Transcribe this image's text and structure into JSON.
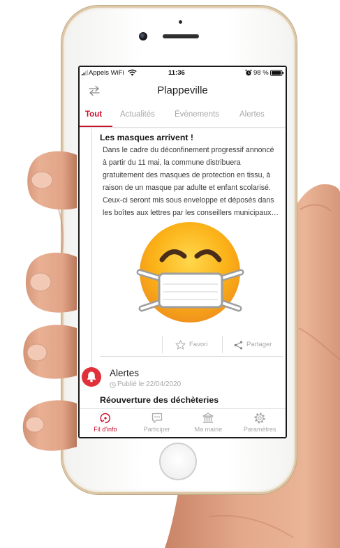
{
  "status_bar": {
    "carrier": "Appels WiFi",
    "time": "11:36",
    "battery": "98 %"
  },
  "header": {
    "title": "Plappeville",
    "left_icon": "swap-arrows-icon"
  },
  "tabs": [
    {
      "label": "Tout",
      "active": true
    },
    {
      "label": "Actualités",
      "active": false
    },
    {
      "label": "Évènements",
      "active": false
    },
    {
      "label": "Alertes",
      "active": false
    }
  ],
  "feed": [
    {
      "title": "Les masques arrivent !",
      "body_lines": [
        "Dans le cadre du déconfinement progressif annoncé",
        "à partir du 11 mai, la commune distribuera",
        "gratuitement des masques de protection en tissu, à",
        "raison de un masque par adulte et enfant scolarisé.",
        "Ceux-ci seront mis sous enveloppe et déposés dans",
        "les boîtes aux lettres par les conseillers municipaux…"
      ],
      "image": "face-with-medical-mask-emoji",
      "actions": {
        "favorite": "Favori",
        "favorite_icon": "star-outline-icon",
        "share": "Partager",
        "share_icon": "share-icon"
      }
    },
    {
      "category": "Alertes",
      "category_icon": "bell-icon",
      "published": "Publié le 22/04/2020",
      "title": "Réouverture des déchèteries"
    }
  ],
  "bottom_nav": [
    {
      "label": "Fil d'info",
      "icon": "news-feed-icon",
      "active": true
    },
    {
      "label": "Participer",
      "icon": "chat-bubble-icon",
      "active": false
    },
    {
      "label": "Ma mairie",
      "icon": "town-hall-icon",
      "active": false
    },
    {
      "label": "Paramètres",
      "icon": "gear-icon",
      "active": false
    }
  ],
  "colors": {
    "accent": "#c8102e",
    "inactive": "#a8a8a8",
    "text": "#1f1f1f",
    "emoji_face": "#fbb117"
  }
}
